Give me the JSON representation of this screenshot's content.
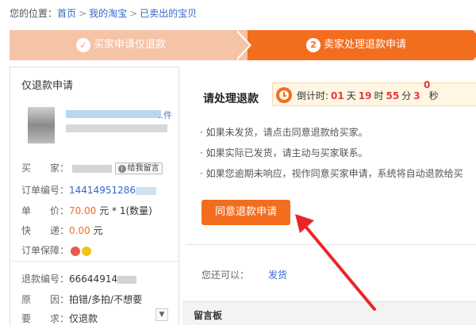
{
  "breadcrumb": {
    "prefix": "您的位置：",
    "items": [
      "首页",
      "我的淘宝",
      "已卖出的宝贝"
    ],
    "separator": ">"
  },
  "steps": {
    "step1": {
      "icon": "check-icon",
      "label": "买家申请仅退款"
    },
    "step2": {
      "number": "2",
      "label": "卖家处理退款申请"
    }
  },
  "order": {
    "title": "仅退款申请",
    "product_label": "..件",
    "buyer_label": "买　　家：",
    "msg_button": "给我留言",
    "order_no_label": "订单编号：",
    "order_no": "14414951286",
    "price_label": "单　　价：",
    "price": "70.00",
    "price_unit": "元 * 1(数量)",
    "shipping_label": "快　　递：",
    "shipping": "0.00",
    "shipping_unit": "元",
    "guarantee_label": "订单保障：",
    "refund_no_label": "退款编号：",
    "refund_no": "66644914",
    "reason_label": "原　　因：",
    "reason": "拍错/多拍/不想要",
    "request_label": "要　　求：",
    "request": "仅退款"
  },
  "process": {
    "title": "请处理退款",
    "countdown_label": "倒计时:",
    "days": "01",
    "days_unit": "天",
    "hours": "19",
    "hours_unit": "时",
    "minutes": "55",
    "minutes_unit": "分",
    "seconds": "3",
    "seconds_unit": "秒",
    "seconds_sup": "0",
    "bullets": [
      "如果未发货，请点击同意退款给买家。",
      "如果实际已发货，请主动与买家联系。",
      "如果您逾期未响应，视作同意买家申请，系统将自动退款给买"
    ],
    "agree_button": "同意退款申请",
    "you_can_label": "您还可以：",
    "ship_link": "发货",
    "message_board": "留言板"
  },
  "colors": {
    "accent": "#f36d1f",
    "step_done": "#f5c3a6",
    "link": "#3366cc",
    "countdown": "#e4393c",
    "arrow": "#e8262a"
  }
}
